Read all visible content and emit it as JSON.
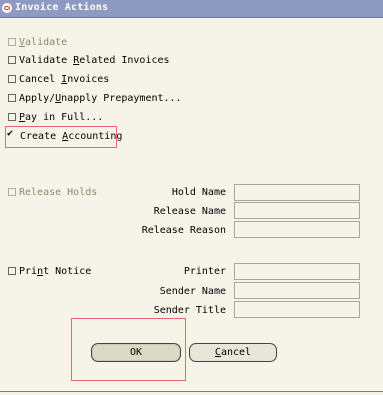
{
  "window": {
    "title": "Invoice Actions"
  },
  "actions": [
    {
      "name": "validate",
      "label": "Validate",
      "underline": "V",
      "rest": "alidate",
      "enabled": false,
      "checked": false
    },
    {
      "name": "validate-related",
      "pre": "Validate ",
      "underline": "R",
      "rest": "elated Invoices",
      "enabled": true,
      "checked": false
    },
    {
      "name": "cancel-invoices",
      "pre": "Cancel ",
      "underline": "I",
      "rest": "nvoices",
      "enabled": true,
      "checked": false
    },
    {
      "name": "apply-prepayment",
      "pre": "Apply/",
      "underline": "U",
      "rest": "napply Prepayment...",
      "enabled": true,
      "checked": false
    },
    {
      "name": "pay-in-full",
      "pre": "",
      "underline": "P",
      "rest": "ay in Full...",
      "enabled": true,
      "checked": false
    },
    {
      "name": "create-accounting",
      "pre": "Create ",
      "underline": "A",
      "rest": "ccounting",
      "enabled": true,
      "checked": true
    }
  ],
  "release": {
    "checkbox_label": "Release Holds",
    "fields": [
      "Hold Name",
      "Release Name",
      "Release Reason"
    ]
  },
  "print": {
    "checkbox_pre": "Pri",
    "checkbox_underline": "n",
    "checkbox_rest": "t Notice",
    "fields": [
      "Printer",
      "Sender Name",
      "Sender Title"
    ]
  },
  "buttons": {
    "ok": "OK",
    "cancel_underline": "C",
    "cancel_rest": "ancel"
  },
  "colors": {
    "background": "#f6f4e8",
    "titlebar": "#8e9ac2",
    "highlight": "#e8676b"
  }
}
